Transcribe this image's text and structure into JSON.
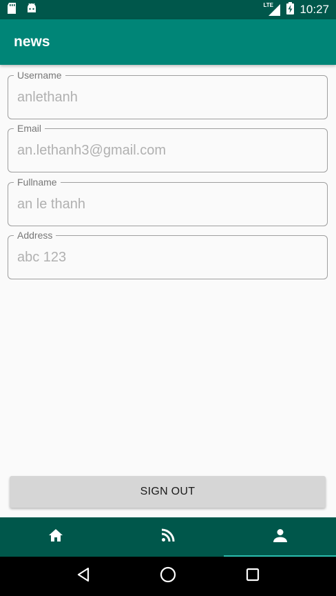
{
  "status_bar": {
    "time": "10:27",
    "network": "LTE",
    "icons": [
      "sd-card-icon",
      "android-icon",
      "signal-icon",
      "battery-charging-icon"
    ]
  },
  "app_bar": {
    "title": "news"
  },
  "profile": {
    "username": {
      "label": "Username",
      "value": "anlethanh"
    },
    "email": {
      "label": "Email",
      "value": "an.lethanh3@gmail.com"
    },
    "fullname": {
      "label": "Fullname",
      "value": "an le thanh"
    },
    "address": {
      "label": "Address",
      "value": "abc 123"
    }
  },
  "actions": {
    "sign_out_label": "SIGN OUT"
  },
  "bottom_nav": {
    "items": [
      {
        "icon": "home-icon",
        "active": false
      },
      {
        "icon": "rss-feed-icon",
        "active": false
      },
      {
        "icon": "person-icon",
        "active": true
      }
    ]
  },
  "system_nav": {
    "icons": [
      "back-icon",
      "home-circle-icon",
      "recents-icon"
    ]
  },
  "colors": {
    "primary": "#008577",
    "primary_dark": "#00574b",
    "accent_indicator": "#2bbfb0",
    "button": "#d6d6d6"
  }
}
